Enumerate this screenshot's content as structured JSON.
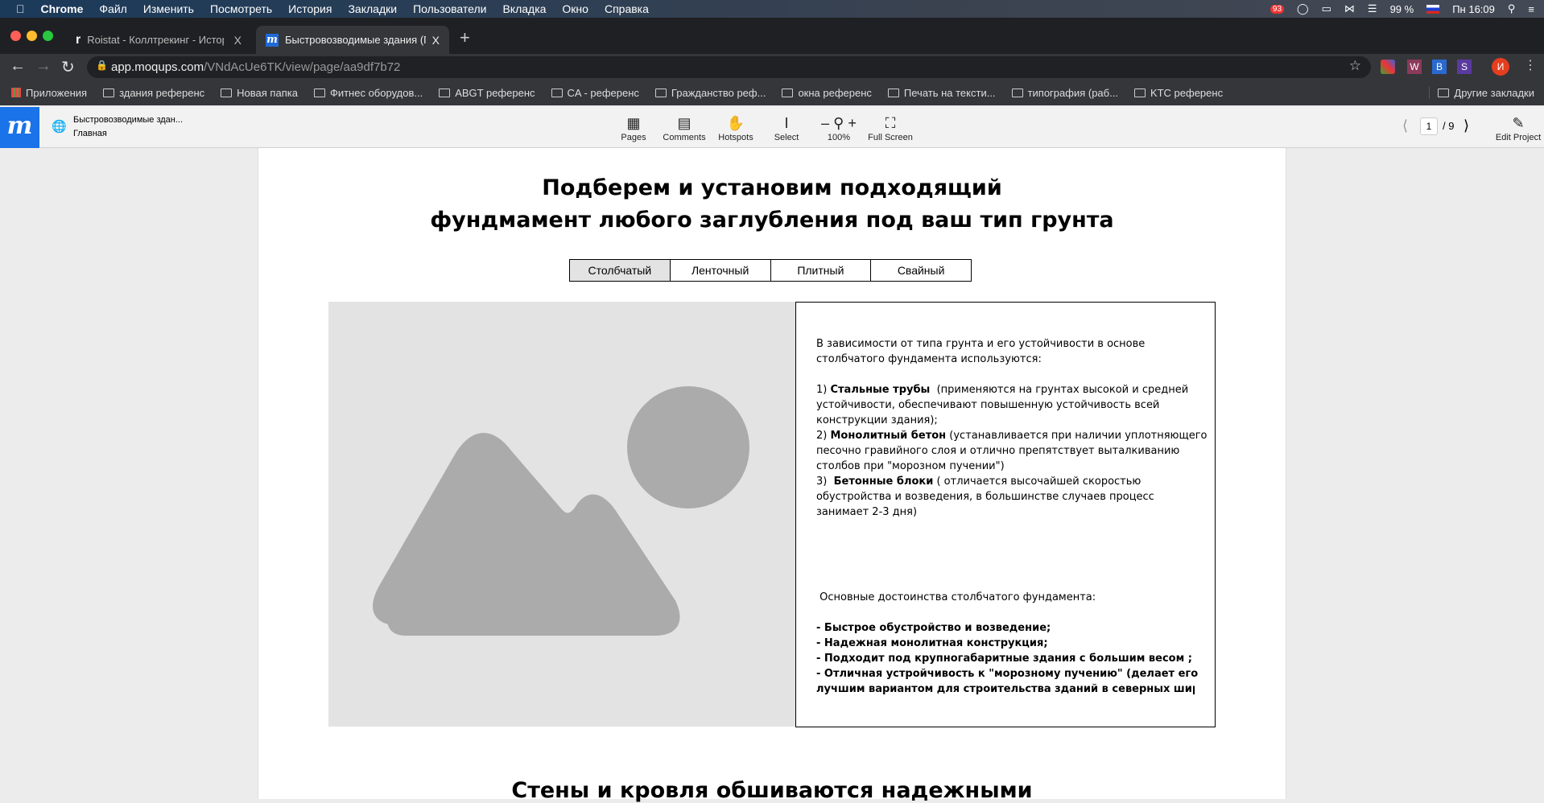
{
  "menubar": {
    "app": "Chrome",
    "items": [
      "Файл",
      "Изменить",
      "Посмотреть",
      "История",
      "Закладки",
      "Пользователи",
      "Вкладка",
      "Окно",
      "Справка"
    ],
    "badge": "93",
    "battery": "99 %",
    "clock": "Пн 16:09"
  },
  "tabs": [
    {
      "title": "Roistat - Коллтрекинг - История",
      "close": "X"
    },
    {
      "title": "Быстровозводимые здания (Прототип)",
      "close": "X"
    }
  ],
  "new_tab": "+",
  "address": {
    "host": "app.moqups.com",
    "path": "/VNdAcUe6TK/view/page/aa9df7b72"
  },
  "extensions": [
    "W",
    "B",
    "S"
  ],
  "profile": "И",
  "bookmarks": [
    "Приложения",
    "здания референс",
    "Новая папка",
    "Фитнес оборудов...",
    "ABGT референс",
    "CA - референс",
    "Гражданство реф...",
    "окна референс",
    "Печать на тексти...",
    "типография (раб...",
    "KTC референс"
  ],
  "other_bookmarks": "Другие закладки",
  "moqups": {
    "logo": "m",
    "project": "Быстровозводимые здан...",
    "page": "Главная",
    "tools": [
      "Pages",
      "Comments",
      "Hotspots",
      "Select",
      "100%",
      "Full Screen"
    ],
    "page_num": "1",
    "page_total": "/ 9",
    "edit": "Edit Project"
  },
  "content": {
    "title1": "Подберем и установим подходящий",
    "title2": "фундмамент любого заглубления под ваш тип грунта",
    "tabs": [
      "Столбчатый",
      "Ленточный",
      "Плитный",
      "Свайный"
    ],
    "selected_tab": 0,
    "intro1": "В зависимости от типа грунта и его устойчивости в основе",
    "intro2": "столбчатого фундамента используются:",
    "i1n": "1) ",
    "i1b": "Стальные трубы",
    "i1t": "  (применяются на грунтах высокой и средней",
    "i1l2": "устойчивости, обеспечивают повышенную устойчивость всей",
    "i1l3": "конструкции здания);",
    "i2n": "2) ",
    "i2b": "Монолитный бетон",
    "i2t": " (устанавливается при наличии уплотняющего",
    "i2l2": "песочно гравийного слоя и отлично препятствует выталкиванию",
    "i2l3": "столбов при \"морозном пучении\")",
    "i3n": "3)  ",
    "i3b": "Бетонные блоки",
    "i3t": " ( отличается высочайшей скоростью",
    "i3l2": "обустройства и возведения, в большинстве случаев процесс",
    "i3l3": "занимает 2-3 дня)",
    "benefits_title": " Основные достоинства столбчатого фундамента:",
    "benefits": [
      "- Быстрое обустройство и возведение;",
      "- Надежная монолитная конструкция;",
      "- Подходит под крупногабаритные здания с большим весом ;",
      "- Отличная устройчивость к \"морозному пучению\" (делает его",
      "лучшим вариантом для строительства зданий в северных широта:"
    ],
    "next_title": "Стены и кровля обшиваются надежными"
  }
}
